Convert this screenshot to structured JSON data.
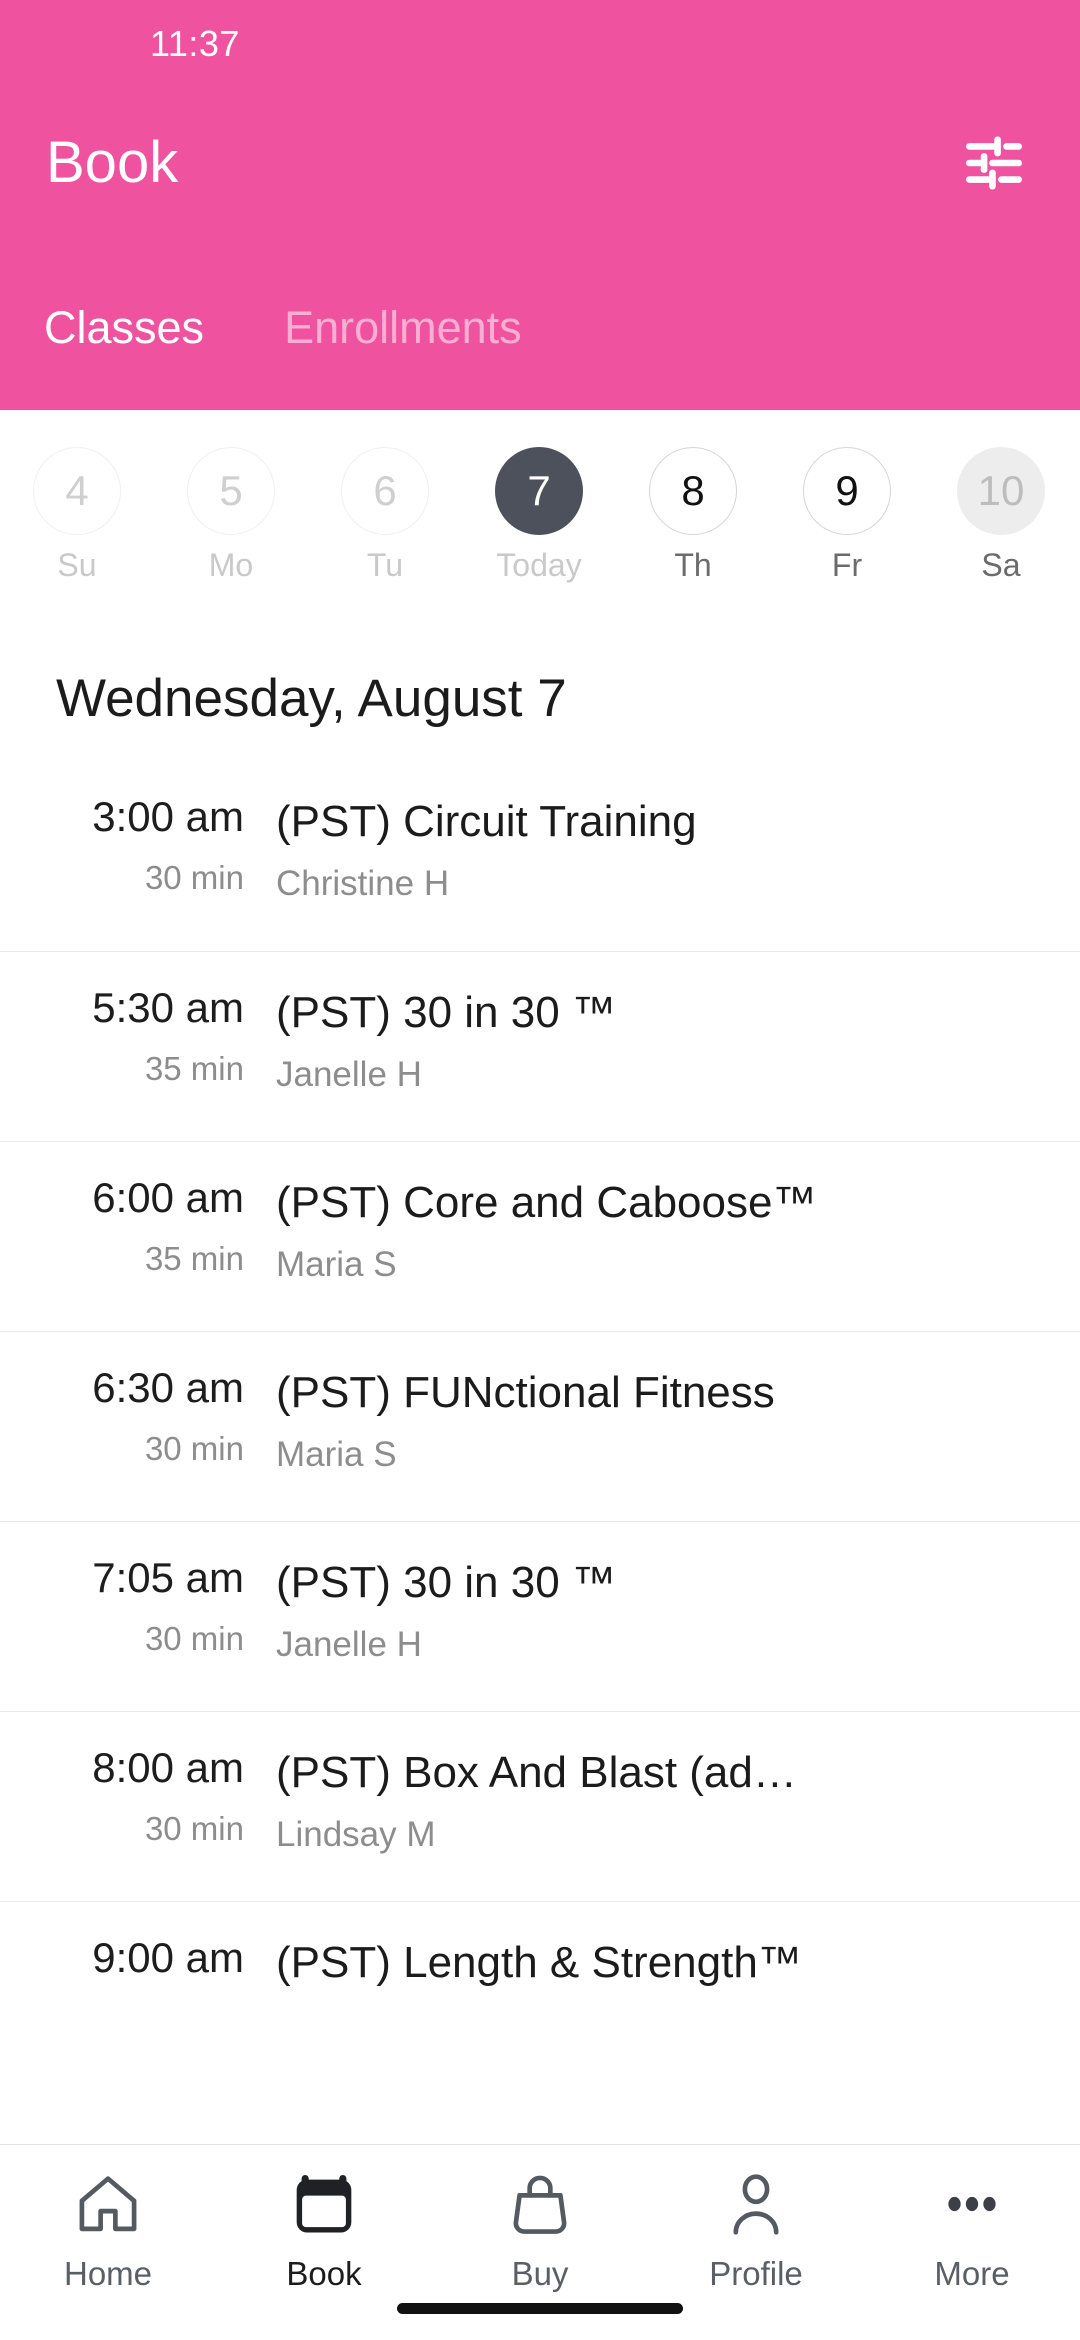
{
  "status": {
    "time": "11:37"
  },
  "header": {
    "title": "Book",
    "filter_icon": "tune-icon",
    "accent_color": "#ef539f",
    "tabs": [
      {
        "label": "Classes",
        "active": true
      },
      {
        "label": "Enrollments",
        "active": false
      }
    ]
  },
  "date_strip": [
    {
      "day": "4",
      "weekday": "Su",
      "state": "disabled"
    },
    {
      "day": "5",
      "weekday": "Mo",
      "state": "disabled"
    },
    {
      "day": "6",
      "weekday": "Tu",
      "state": "disabled"
    },
    {
      "day": "7",
      "weekday": "Today",
      "state": "selected"
    },
    {
      "day": "8",
      "weekday": "Th",
      "state": "available"
    },
    {
      "day": "9",
      "weekday": "Fr",
      "state": "available"
    },
    {
      "day": "10",
      "weekday": "Sa",
      "state": "muted"
    }
  ],
  "day_title": "Wednesday, August 7",
  "classes": [
    {
      "time": "3:00 am",
      "duration": "30 min",
      "name": "(PST) Circuit Training",
      "coach": "Christine H"
    },
    {
      "time": "5:30 am",
      "duration": "35 min",
      "name": "(PST) 30 in 30 ™",
      "coach": "Janelle H"
    },
    {
      "time": "6:00 am",
      "duration": "35 min",
      "name": "(PST) Core and Caboose™",
      "coach": "Maria S"
    },
    {
      "time": "6:30 am",
      "duration": "30 min",
      "name": "(PST) FUNctional Fitness",
      "coach": "Maria S"
    },
    {
      "time": "7:05 am",
      "duration": "30 min",
      "name": "(PST) 30 in 30 ™",
      "coach": "Janelle H"
    },
    {
      "time": "8:00 am",
      "duration": "30 min",
      "name": "(PST) Box And Blast (ad…",
      "coach": "Lindsay M"
    },
    {
      "time": "9:00 am",
      "duration": "",
      "name": "(PST) Length & Strength™",
      "coach": ""
    }
  ],
  "bottom_nav": [
    {
      "label": "Home",
      "icon": "home-icon",
      "active": false
    },
    {
      "label": "Book",
      "icon": "calendar-icon",
      "active": true
    },
    {
      "label": "Buy",
      "icon": "bag-icon",
      "active": false
    },
    {
      "label": "Profile",
      "icon": "person-icon",
      "active": false
    },
    {
      "label": "More",
      "icon": "ellipsis-icon",
      "active": false
    }
  ]
}
